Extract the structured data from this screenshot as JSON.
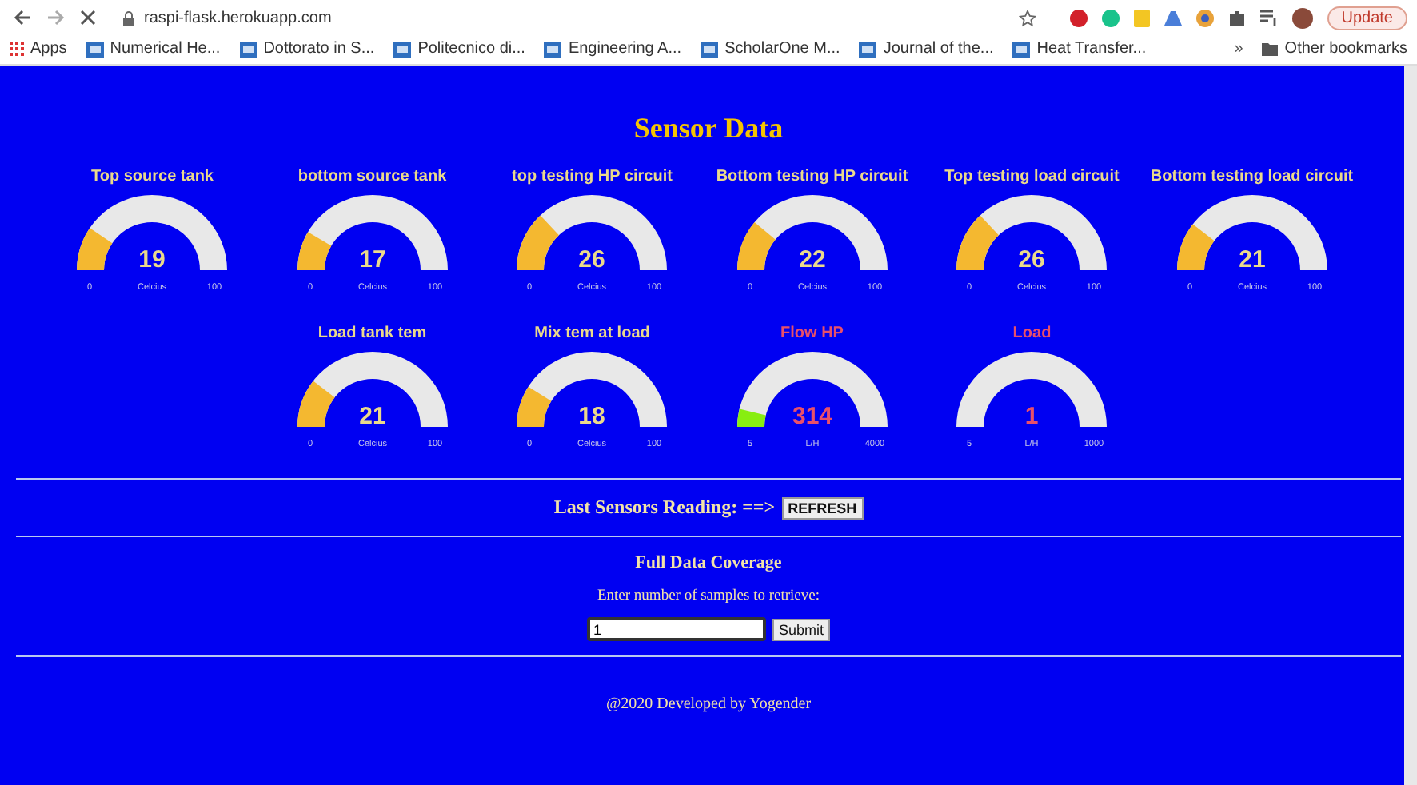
{
  "browser": {
    "url": "raspi-flask.herokuapp.com",
    "update_button": "Update",
    "bookmarks": [
      {
        "label": "Apps",
        "kind": "apps"
      },
      {
        "label": "Numerical He...",
        "kind": "page"
      },
      {
        "label": "Dottorato in S...",
        "kind": "page"
      },
      {
        "label": "Politecnico di...",
        "kind": "page"
      },
      {
        "label": "Engineering A...",
        "kind": "page"
      },
      {
        "label": "ScholarOne M...",
        "kind": "page"
      },
      {
        "label": "Journal of the...",
        "kind": "page"
      },
      {
        "label": "Heat Transfer...",
        "kind": "page"
      }
    ],
    "more": "»",
    "other_bookmarks": "Other bookmarks"
  },
  "page": {
    "title": "Sensor Data",
    "gauges": [
      {
        "title": "Top source tank",
        "kind": "temperature",
        "value": "19",
        "unit": "Celcius",
        "min": "0",
        "max": "100"
      },
      {
        "title": "bottom source tank",
        "kind": "temperature",
        "value": "17",
        "unit": "Celcius",
        "min": "0",
        "max": "100"
      },
      {
        "title": "top testing HP circuit",
        "kind": "temperature",
        "value": "26",
        "unit": "Celcius",
        "min": "0",
        "max": "100"
      },
      {
        "title": "Bottom testing HP circuit",
        "kind": "temperature",
        "value": "22",
        "unit": "Celcius",
        "min": "0",
        "max": "100"
      },
      {
        "title": "Top testing load circuit",
        "kind": "temperature",
        "value": "26",
        "unit": "Celcius",
        "min": "0",
        "max": "100"
      },
      {
        "title": "Bottom testing load circuit",
        "kind": "temperature",
        "value": "21",
        "unit": "Celcius",
        "min": "0",
        "max": "100"
      },
      {
        "title": "Load tank tem",
        "kind": "temperature",
        "value": "21",
        "unit": "Celcius",
        "min": "0",
        "max": "100"
      },
      {
        "title": "Mix tem at load",
        "kind": "temperature",
        "value": "18",
        "unit": "Celcius",
        "min": "0",
        "max": "100"
      },
      {
        "title": "Flow HP",
        "kind": "flow",
        "value": "314",
        "unit": "L/H",
        "min": "5",
        "max": "4000"
      },
      {
        "title": "Load",
        "kind": "flow",
        "value": "1",
        "unit": "L/H",
        "min": "5",
        "max": "1000"
      }
    ],
    "last_reading_label": "Last Sensors Reading: ==>",
    "refresh_button": "REFRESH",
    "coverage_title": "Full Data Coverage",
    "samples_prompt": "Enter number of samples to retrieve:",
    "samples_value": "1",
    "submit_button": "Submit",
    "footer": "@2020 Developed by Yogender"
  }
}
